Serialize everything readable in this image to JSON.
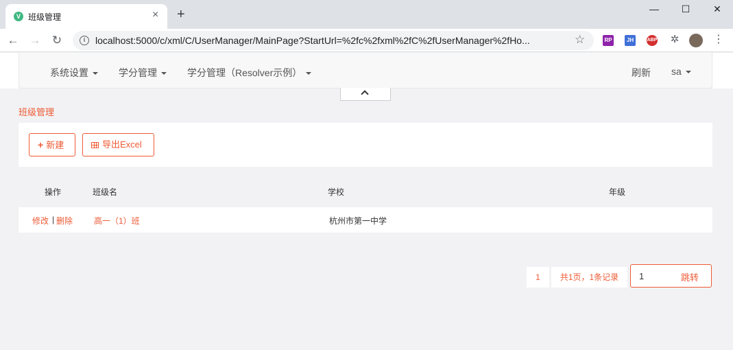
{
  "browser": {
    "tab_title": "班级管理",
    "favicon_letter": "V",
    "tab_close": "×",
    "new_tab": "+",
    "url": "localhost:5000/c/xml/C/UserManager/MainPage?StartUrl=%2fc%2fxml%2fC%2fUserManager%2fHo...",
    "window_controls": {
      "minimize": "—",
      "maximize": "☐",
      "close": "✕"
    },
    "nav": {
      "back": "←",
      "forward": "→",
      "reload": "↻",
      "star": "☆"
    },
    "extensions": [
      "RP",
      "JH",
      "ABP"
    ],
    "extensions_icon": "puzzle-icon",
    "menu": "⋮"
  },
  "navbar": {
    "items": [
      "系统设置",
      "学分管理",
      "学分管理（Resolver示例）"
    ],
    "refresh": "刷新",
    "user": "sa"
  },
  "page": {
    "title": "班级管理",
    "buttons": {
      "new": "新建",
      "export": "导出Excel"
    }
  },
  "table": {
    "headers": {
      "op": "操作",
      "name": "班级名",
      "school": "学校",
      "grade": "年级"
    },
    "rows": [
      {
        "edit": "修改",
        "sep": "|",
        "delete": "删除",
        "name": "高一（1）班",
        "school": "杭州市第一中学",
        "grade": ""
      }
    ]
  },
  "pagination": {
    "current_page": "1",
    "summary": "共1页，1条记录",
    "jump_value": "1",
    "jump_label": "跳转"
  },
  "colors": {
    "accent": "#ee5a34",
    "background": "#f2f2f4"
  }
}
